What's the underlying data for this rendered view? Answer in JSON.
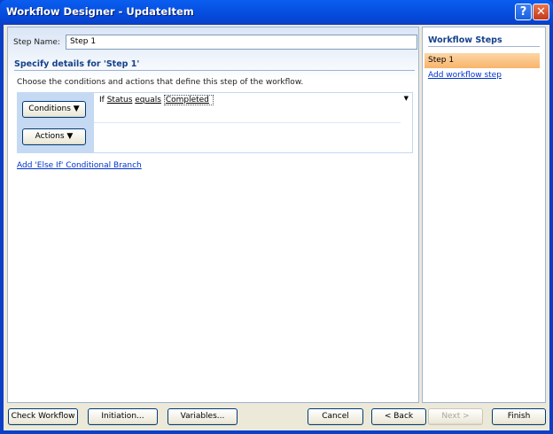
{
  "window": {
    "title": "Workflow Designer - UpdateItem",
    "help": "?",
    "close": "✕"
  },
  "step_name": {
    "label": "Step Name:",
    "value": "Step 1"
  },
  "details": {
    "heading": "Specify details for 'Step 1'",
    "description": "Choose the conditions and actions that define this step of the workflow.",
    "conditions_button": "Conditions ▼",
    "actions_button": "Actions ▼",
    "condition": {
      "if": "If",
      "field": "Status",
      "operator": "equals",
      "value": "Completed"
    },
    "add_branch": "Add 'Else If' Conditional Branch"
  },
  "steps_panel": {
    "heading": "Workflow Steps",
    "steps": [
      "Step 1"
    ],
    "add_link": "Add workflow step"
  },
  "buttons": {
    "check": "Check Workflow",
    "initiation": "Initiation...",
    "variables": "Variables...",
    "cancel": "Cancel",
    "back": "< Back",
    "next": "Next >",
    "finish": "Finish"
  }
}
